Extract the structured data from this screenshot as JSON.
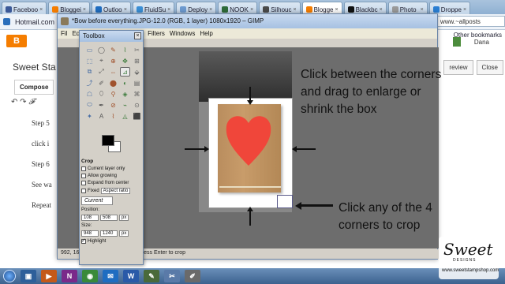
{
  "browser": {
    "tabs": [
      {
        "label": "Faceboo",
        "color": "#3b5998"
      },
      {
        "label": "Bloggei",
        "color": "#f57d00"
      },
      {
        "label": "Outloo",
        "color": "#1f6dc1"
      },
      {
        "label": "FluidSu",
        "color": "#3a8fd6"
      },
      {
        "label": "Deploy",
        "color": "#6d9ad0"
      },
      {
        "label": "NOOK",
        "color": "#2e6b3a"
      },
      {
        "label": "Silhouc",
        "color": "#4a4a4a"
      },
      {
        "label": "Blogge",
        "color": "#f57d00"
      },
      {
        "label": "Blackbc",
        "color": "#111111"
      },
      {
        "label": "Photo",
        "color": "#9a9a9a"
      },
      {
        "label": "Droppe",
        "color": "#2a7ed3"
      }
    ],
    "bookmark_label": "Hotmail.com",
    "address": "www.~allposts",
    "other_bookmarks": "Other bookmarks"
  },
  "blogger": {
    "logo": "B",
    "blog_title": "Sweet Sta",
    "compose_tab": "Compose",
    "user_name": "Dana",
    "preview_button": "review",
    "close_button": "Close",
    "post_lines": [
      "Step 5",
      "click i",
      "Step 6",
      "See wa",
      "Repeat"
    ]
  },
  "gimp": {
    "window_title": "*Bow before everything.JPG-12.0 (RGB, 1 layer) 1080x1920 – GIMP",
    "menu": [
      "Fil",
      "Ed",
      "Layer",
      "Colors",
      "Tools",
      "Filters",
      "Windows",
      "Help"
    ],
    "status_left": "992, 16",
    "status_text": "k or press Enter to crop"
  },
  "toolbox": {
    "title": "Toolbox",
    "tool_options_header": "Crop",
    "options": [
      {
        "label": "Current layer only",
        "checked": false
      },
      {
        "label": "Allow growing",
        "checked": false
      },
      {
        "label": "Expand from center",
        "checked": false
      }
    ],
    "fixed_label": "Fixed",
    "fixed_select": "Aspect ratio",
    "current_label": "Current",
    "position_label": "Position:",
    "position_unit": "px",
    "position_x": "108",
    "position_y": "508",
    "size_label": "Size:",
    "size_unit": "px",
    "size_w": "948",
    "size_h": "1240",
    "highlight_label": "Highlight",
    "highlight_checked": true
  },
  "annotations": {
    "drag_text_1": "Click between the corners",
    "drag_text_2": "and drag to enlarge or",
    "drag_text_3": "shrink the box",
    "corner_text_1": "Click any of the 4",
    "corner_text_2": "corners to crop"
  },
  "watermark": {
    "brand": "Sweet",
    "sub": "DESIGNS",
    "url": "www.sweetstampshop.com"
  }
}
